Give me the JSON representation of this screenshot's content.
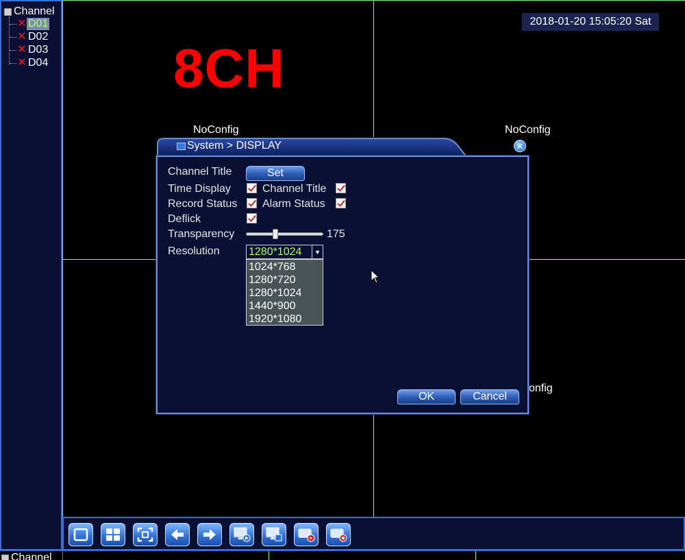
{
  "sidebar": {
    "title": "Channel",
    "channels": [
      "D01",
      "D02",
      "D03",
      "D04"
    ],
    "selected": "D01"
  },
  "overlay": {
    "big_text": "8CH"
  },
  "datetime": "2018-01-20 15:05:20 Sat",
  "noconfig": [
    "NoConfig",
    "NoConfig",
    "onfig"
  ],
  "dialog": {
    "breadcrumb": "System > DISPLAY",
    "channel_title_label": "Channel Title",
    "set_button": "Set",
    "time_display_label": "Time Display",
    "channel_title_chk_label": "Channel Title",
    "record_status_label": "Record Status",
    "alarm_status_label": "Alarm Status",
    "deflick_label": "Deflick",
    "checks": {
      "time_display": true,
      "channel_title": true,
      "record_status": true,
      "alarm_status": true,
      "deflick": true
    },
    "transparency_label": "Transparency",
    "transparency_value": "175",
    "transparency_fraction": 0.37,
    "resolution_label": "Resolution",
    "resolution_value": "1280*1024",
    "resolution_options": [
      "1024*768",
      "1280*720",
      "1280*1024",
      "1440*900",
      "1920*1080"
    ],
    "ok_button": "OK",
    "cancel_button": "Cancel"
  },
  "toolbar": {
    "buttons": [
      "single-view-icon",
      "quad-view-icon",
      "fullscreen-icon",
      "prev-arrow-icon",
      "next-arrow-icon",
      "playback-monitor-icon",
      "monitor-settings-icon",
      "record-start-icon",
      "record-stop-icon"
    ]
  },
  "bottom_strip": {
    "label": "Channel"
  },
  "colors": {
    "accent_blue": "#3a6fd8",
    "alert_red": "#ff0000",
    "selected_green": "#b7ff73"
  }
}
